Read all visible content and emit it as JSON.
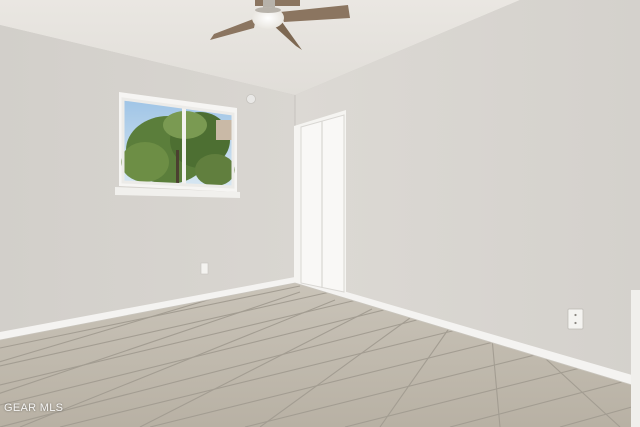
{
  "photo": {
    "watermark": "GEAR MLS"
  },
  "colors": {
    "ceiling": "#e6e3de",
    "left_wall": "#d4d1cc",
    "right_wall": "#dad7d2",
    "floor_tile": "#bdb7ab",
    "grout": "#a39d92",
    "baseboard": "#f4f3f1",
    "trim": "#f2f1ee"
  }
}
